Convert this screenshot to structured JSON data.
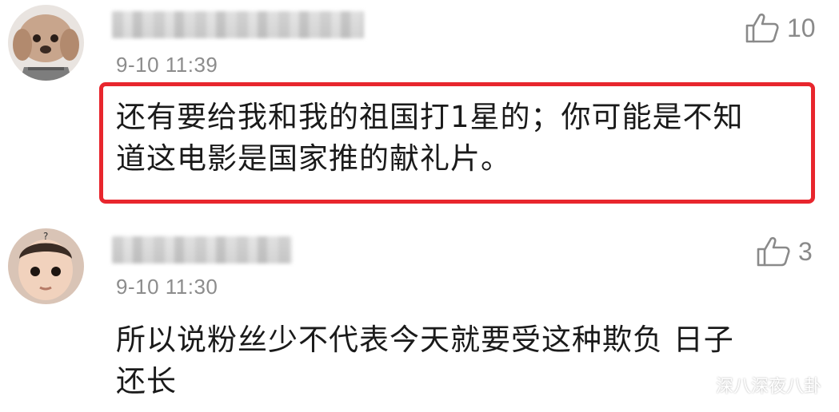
{
  "comments": [
    {
      "timestamp": "9-10 11:39",
      "likes": "10",
      "text_lines": [
        "还有要给我和我的祖国打1星的；你可能是不知",
        "道这电影是国家推的献礼片。"
      ],
      "highlighted": true
    },
    {
      "timestamp": "9-10 11:30",
      "likes": "3",
      "text_lines": [
        "所以说粉丝少不代表今天就要受这种欺负 日子",
        "还长"
      ],
      "highlighted": false
    }
  ],
  "watermark": {
    "text": "深八深夜八卦",
    "icon": "wechat-icon"
  },
  "colors": {
    "highlight": "#e8262d",
    "meta": "#8c8c8c",
    "like": "#8a8a8a"
  }
}
